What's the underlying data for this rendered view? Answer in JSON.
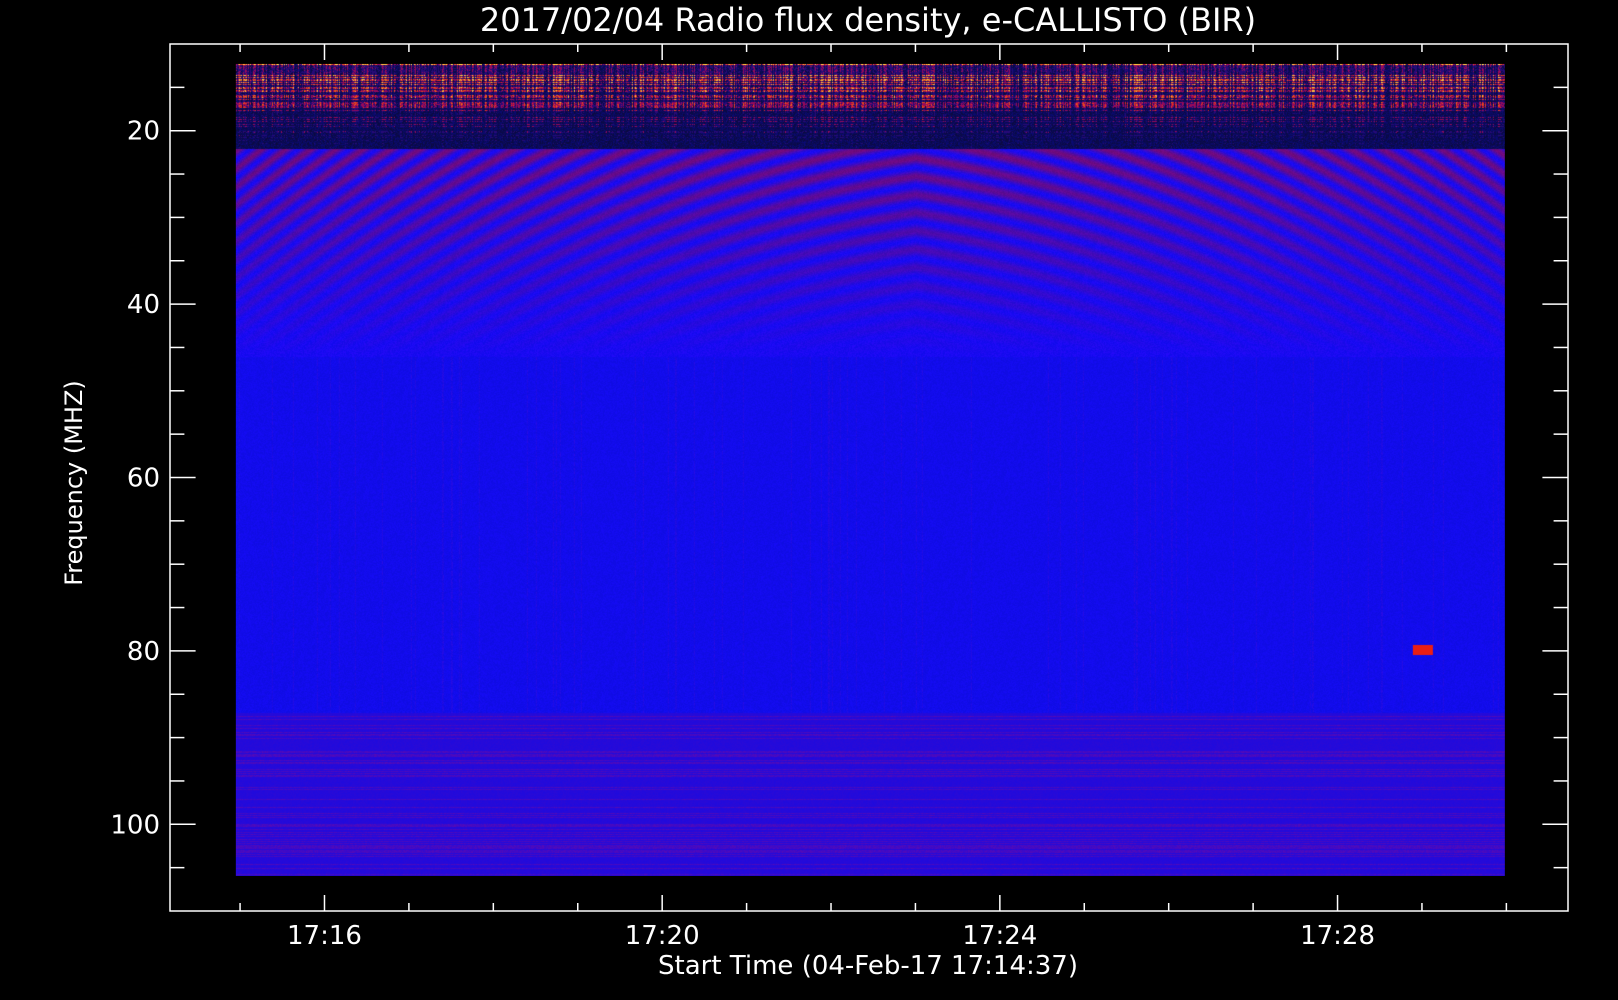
{
  "chart_data": {
    "type": "heatmap",
    "title": "2017/02/04  Radio flux density, e-CALLISTO (BIR)",
    "xlabel": "Start Time (04-Feb-17 17:14:37)",
    "ylabel": "Frequency (MHZ)",
    "x_tick_labels": [
      "17:16",
      "17:20",
      "17:24",
      "17:28"
    ],
    "x_tick_minutes": [
      16,
      20,
      24,
      28
    ],
    "x_minor_minutes": [
      15,
      16,
      17,
      18,
      19,
      20,
      21,
      22,
      23,
      24,
      25,
      26,
      27,
      28,
      29,
      30
    ],
    "xlim_minutes": [
      14.17,
      30.73
    ],
    "data_time_range_minutes": [
      14.95,
      29.98
    ],
    "y_tick_labels": [
      "20",
      "40",
      "60",
      "80",
      "100"
    ],
    "y_ticks": [
      20,
      40,
      60,
      80,
      100
    ],
    "y_minor_step": 5,
    "ylim": [
      10,
      110
    ],
    "data_freq_range": [
      12.3,
      105.9
    ],
    "y_inverted": true,
    "grid": false,
    "colors": {
      "background": "#000000",
      "axis": "#ffffff",
      "noise": "#1414f0",
      "emission_low": "#7a0a5c",
      "emission_mid": "#e01818",
      "emission_high": "#ffb020",
      "emission_peak": "#fff0b0"
    },
    "features": [
      {
        "kind": "rfi_band",
        "freq_range": [
          12.3,
          22
        ],
        "intensity": "high"
      },
      {
        "kind": "curved_stripes",
        "freq_range": [
          22,
          45
        ],
        "vertex_minute": 23.0,
        "intensity": "low"
      },
      {
        "kind": "rfi_band",
        "freq_range": [
          87,
          106
        ],
        "intensity": "low"
      },
      {
        "kind": "spot",
        "minute": 29.0,
        "freq": 79.8,
        "intensity": "mid"
      }
    ]
  }
}
